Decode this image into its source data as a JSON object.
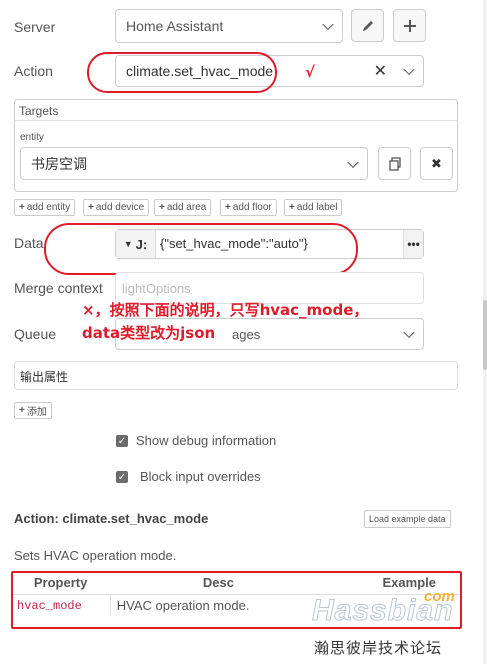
{
  "server": {
    "label": "Server",
    "value": "Home Assistant"
  },
  "action": {
    "label": "Action",
    "value": "climate.set_hvac_mode"
  },
  "targets": {
    "title": "Targets",
    "entity_label": "entity",
    "entity_value": "书房空调",
    "add_buttons": [
      "add entity",
      "add device",
      "add area",
      "add floor",
      "add label"
    ]
  },
  "data": {
    "label": "Data",
    "type_glyph": "J:",
    "value": "{\"set_hvac_mode\":\"auto\"}"
  },
  "merge_context": {
    "label": "Merge context",
    "placeholder": "lightOptions"
  },
  "queue": {
    "label": "Queue",
    "value_visible": "ages"
  },
  "output": {
    "label": "输出属性",
    "add_button": "添加"
  },
  "options": {
    "debug": "Show debug information",
    "block": "Block input overrides"
  },
  "action_doc": {
    "title": "Action: climate.set_hvac_mode",
    "load_button": "Load example data",
    "description": "Sets HVAC operation mode.",
    "headers": [
      "Property",
      "Desc",
      "Example"
    ],
    "rows": [
      {
        "property": "hvac_mode",
        "desc": "HVAC operation mode.",
        "example": ""
      }
    ]
  },
  "annotations": {
    "check_mark": "√",
    "note_line1": "×，按照下面的说明，只写hvac_mode，",
    "note_line2": "data类型改为json",
    "accent_color": "#e01b2a"
  },
  "watermark": {
    "brand": "Hassbian",
    "com": "com",
    "caption": "瀚思彼岸技术论坛"
  }
}
